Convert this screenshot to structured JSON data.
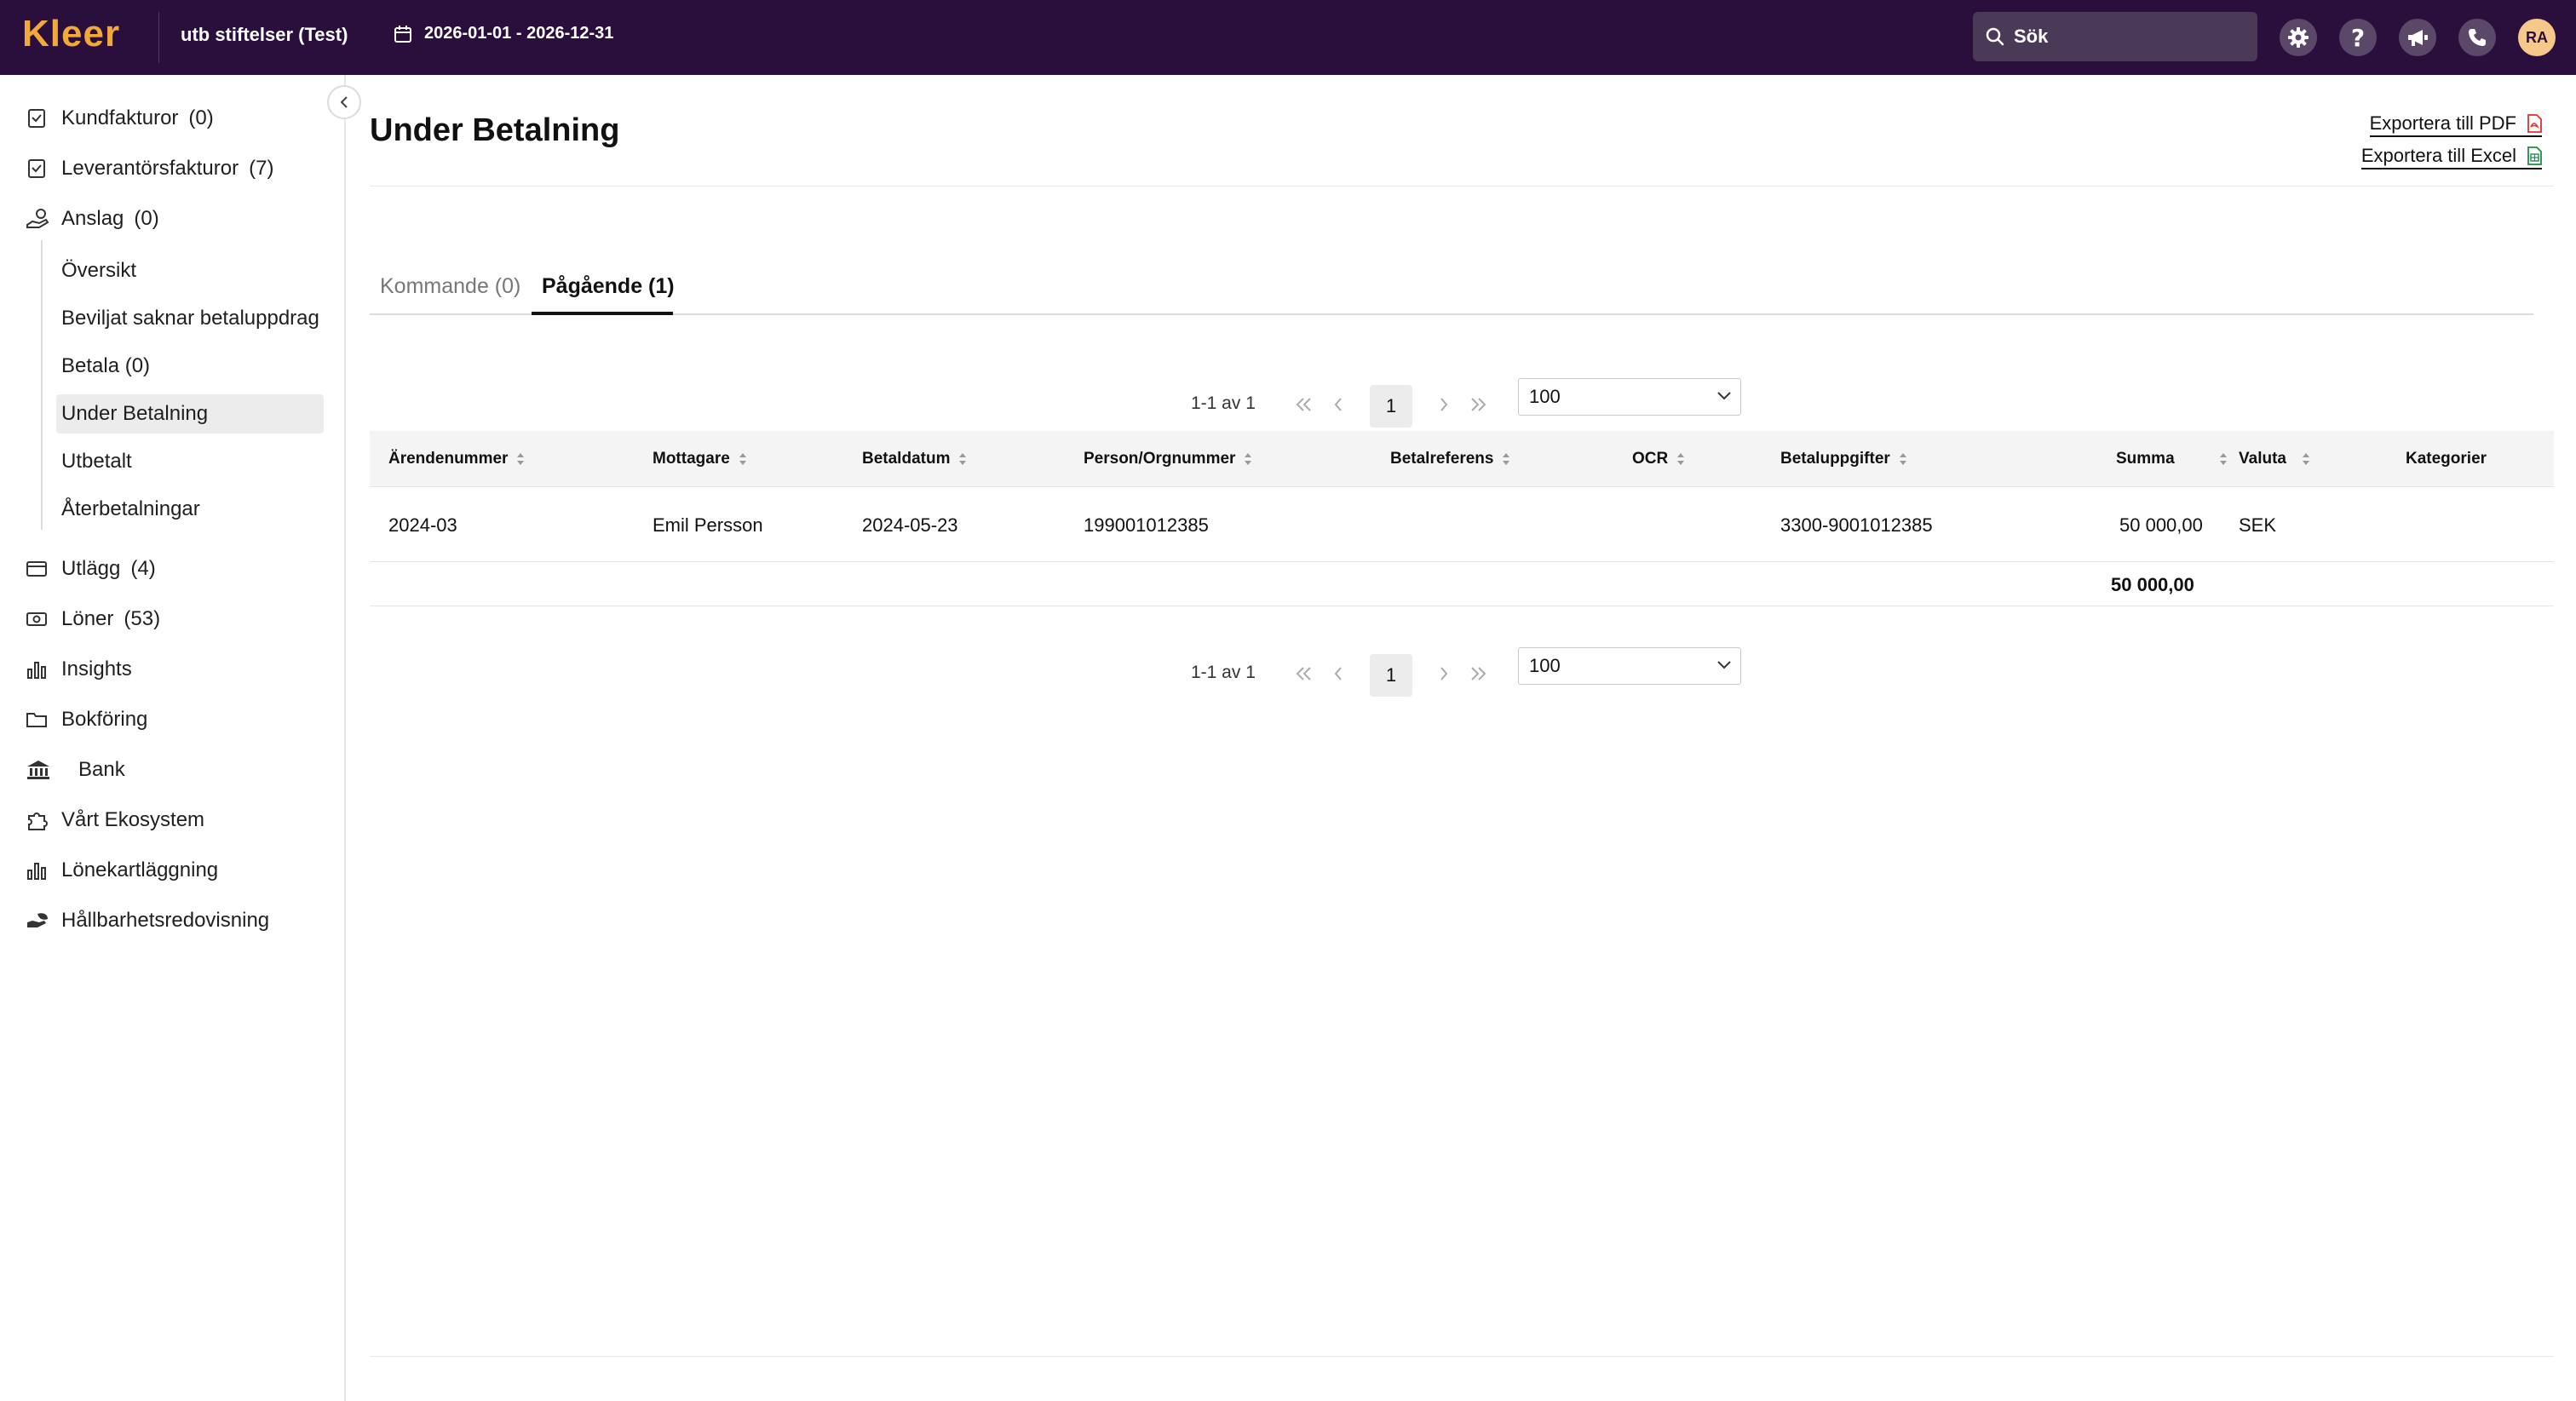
{
  "topbar": {
    "logo": "Kleer",
    "organization": "utb stiftelser (Test)",
    "date_range": "2026-01-01 - 2026-12-31",
    "search_placeholder": "Sök",
    "avatar_initials": "RA",
    "brand_color": "#2a0f3d",
    "logo_color": "#f2a83a"
  },
  "sidebar": {
    "items": [
      {
        "label": "Kundfakturor",
        "count": "(0)",
        "icon": "invoice-icon"
      },
      {
        "label": "Leverantörsfakturor",
        "count": "(7)",
        "icon": "invoice-icon"
      },
      {
        "label": "Anslag",
        "count": "(0)",
        "icon": "hand-coin-icon"
      }
    ],
    "sub_items": [
      {
        "label": "Översikt"
      },
      {
        "label": "Beviljat saknar betaluppdrag"
      },
      {
        "label": "Betala (0)"
      },
      {
        "label": "Under Betalning",
        "active": true
      },
      {
        "label": "Utbetalt"
      },
      {
        "label": "Återbetalningar"
      }
    ],
    "items_after": [
      {
        "label": "Utlägg",
        "count": "(4)",
        "icon": "card-icon"
      },
      {
        "label": "Löner",
        "count": "(53)",
        "icon": "cash-icon"
      },
      {
        "label": "Insights",
        "count": "",
        "icon": "bar-chart-icon"
      },
      {
        "label": "Bokföring",
        "count": "",
        "icon": "folder-icon"
      },
      {
        "label": "Bank",
        "count": "",
        "icon": "bank-icon"
      },
      {
        "label": "Vårt Ekosystem",
        "count": "",
        "icon": "puzzle-icon"
      },
      {
        "label": "Lönekartläggning",
        "count": "",
        "icon": "bar-chart-icon"
      },
      {
        "label": "Hållbarhetsredovisning",
        "count": "",
        "icon": "leaf-hand-icon"
      }
    ]
  },
  "main": {
    "title": "Under Betalning",
    "export_pdf": "Exportera till PDF",
    "export_excel": "Exportera till Excel",
    "tabs": [
      {
        "label": "Kommande (0)",
        "active": false
      },
      {
        "label": "Pågående (1)",
        "active": true
      }
    ],
    "pagination": {
      "range": "1-1 av 1",
      "current_page": "1",
      "page_size": "100"
    },
    "table": {
      "columns": [
        "Ärendenummer",
        "Mottagare",
        "Betaldatum",
        "Person/Orgnummer",
        "Betalreferens",
        "OCR",
        "Betaluppgifter",
        "Summa",
        "Valuta",
        "Kategorier"
      ],
      "rows": [
        {
          "arendenummer": "2024-03",
          "mottagare": "Emil Persson",
          "betaldatum": "2024-05-23",
          "person_orgnummer": "199001012385",
          "betalreferens": "",
          "ocr": "",
          "betaluppgifter": "3300-9001012385",
          "summa": "50 000,00",
          "valuta": "SEK",
          "kategorier": ""
        }
      ],
      "total": "50 000,00"
    }
  }
}
